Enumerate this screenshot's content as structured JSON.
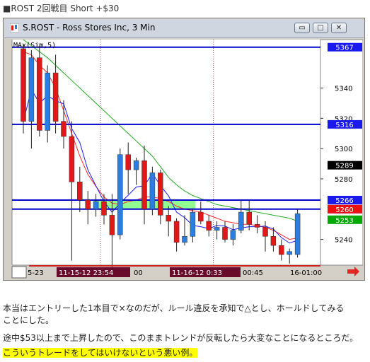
{
  "post_title": "■ROST 2回戦目 Short +$30",
  "window": {
    "title": "S.ROST - Ross Stores Inc, 3 Min",
    "buttons": [
      "▭",
      "□",
      "✕"
    ]
  },
  "chart_data": {
    "type": "candlestick",
    "indicator_label": "MAx(Sim,5)",
    "ylim": [
      5223,
      5372
    ],
    "y_ticks": [
      5340,
      5320,
      5300,
      5280,
      5240
    ],
    "x_tick_labels": [
      "5-23",
      "11-15-12 23:54",
      "00",
      "11-16-12  0:33",
      "00:45",
      "16-01:00"
    ],
    "candles": [
      {
        "o": 5366,
        "h": 5369,
        "l": 5310,
        "c": 5318
      },
      {
        "o": 5318,
        "h": 5365,
        "l": 5300,
        "c": 5360
      },
      {
        "o": 5360,
        "h": 5368,
        "l": 5308,
        "c": 5312
      },
      {
        "o": 5312,
        "h": 5355,
        "l": 5304,
        "c": 5350
      },
      {
        "o": 5350,
        "h": 5362,
        "l": 5310,
        "c": 5318
      },
      {
        "o": 5318,
        "h": 5332,
        "l": 5300,
        "c": 5308
      },
      {
        "o": 5308,
        "h": 5318,
        "l": 5226,
        "c": 5278
      },
      {
        "o": 5278,
        "h": 5288,
        "l": 5258,
        "c": 5266
      },
      {
        "o": 5266,
        "h": 5272,
        "l": 5250,
        "c": 5260
      },
      {
        "o": 5260,
        "h": 5270,
        "l": 5255,
        "c": 5265
      },
      {
        "o": 5265,
        "h": 5270,
        "l": 5250,
        "c": 5256
      },
      {
        "o": 5256,
        "h": 5270,
        "l": 5220,
        "c": 5243
      },
      {
        "o": 5243,
        "h": 5300,
        "l": 5240,
        "c": 5296
      },
      {
        "o": 5296,
        "h": 5304,
        "l": 5270,
        "c": 5286
      },
      {
        "o": 5286,
        "h": 5294,
        "l": 5276,
        "c": 5292
      },
      {
        "o": 5292,
        "h": 5302,
        "l": 5250,
        "c": 5260
      },
      {
        "o": 5260,
        "h": 5288,
        "l": 5256,
        "c": 5284
      },
      {
        "o": 5284,
        "h": 5286,
        "l": 5250,
        "c": 5256
      },
      {
        "o": 5256,
        "h": 5262,
        "l": 5242,
        "c": 5252
      },
      {
        "o": 5252,
        "h": 5254,
        "l": 5232,
        "c": 5238
      },
      {
        "o": 5238,
        "h": 5256,
        "l": 5236,
        "c": 5242
      },
      {
        "o": 5242,
        "h": 5260,
        "l": 5238,
        "c": 5258
      },
      {
        "o": 5258,
        "h": 5265,
        "l": 5250,
        "c": 5252
      },
      {
        "o": 5252,
        "h": 5256,
        "l": 5242,
        "c": 5246
      },
      {
        "o": 5246,
        "h": 5252,
        "l": 5240,
        "c": 5248
      },
      {
        "o": 5248,
        "h": 5252,
        "l": 5238,
        "c": 5240
      },
      {
        "o": 5240,
        "h": 5250,
        "l": 5236,
        "c": 5246
      },
      {
        "o": 5246,
        "h": 5266,
        "l": 5244,
        "c": 5258
      },
      {
        "o": 5258,
        "h": 5266,
        "l": 5246,
        "c": 5250
      },
      {
        "o": 5250,
        "h": 5256,
        "l": 5244,
        "c": 5248
      },
      {
        "o": 5248,
        "h": 5252,
        "l": 5232,
        "c": 5242
      },
      {
        "o": 5242,
        "h": 5248,
        "l": 5232,
        "c": 5236
      },
      {
        "o": 5236,
        "h": 5240,
        "l": 5226,
        "c": 5230
      },
      {
        "o": 5230,
        "h": 5234,
        "l": 5224,
        "c": 5232
      },
      {
        "o": 5230,
        "h": 5260,
        "l": 5228,
        "c": 5257
      }
    ],
    "ma_red": [
      5364,
      5362,
      5355,
      5350,
      5340,
      5325,
      5310,
      5295,
      5283,
      5275,
      5268,
      5264,
      5263,
      5265,
      5266,
      5268,
      5268,
      5267,
      5265,
      5262,
      5260,
      5259,
      5258,
      5256,
      5254,
      5252,
      5251,
      5250,
      5250,
      5249,
      5248,
      5246,
      5243,
      5240,
      5241
    ],
    "ma_green": [
      5372,
      5368,
      5364,
      5360,
      5355,
      5350,
      5345,
      5340,
      5335,
      5330,
      5325,
      5320,
      5315,
      5310,
      5305,
      5300,
      5295,
      5288,
      5281,
      5276,
      5272,
      5269,
      5267,
      5265,
      5263,
      5262,
      5261,
      5260,
      5259,
      5258,
      5257,
      5256,
      5255,
      5254,
      5252
    ],
    "h_lines": [
      {
        "value": 5367,
        "label": "5367",
        "color": "#0000cc"
      },
      {
        "value": 5316,
        "label": "5316",
        "color": "#0000cc"
      },
      {
        "value": 5266,
        "label": "5266",
        "color": "#0000cc"
      },
      {
        "value": 5260,
        "label": "5260",
        "color": "#0000cc"
      }
    ],
    "right_tags": [
      {
        "value": 5289,
        "label": "5289",
        "bg": "#000000",
        "fg": "#ffffff"
      },
      {
        "value": 5253,
        "label": "5253",
        "bg": "#00aa00",
        "fg": "#ffffff"
      },
      {
        "value": 5260,
        "label": "5260",
        "bg": "#ee1111",
        "fg": "#ffffff"
      }
    ],
    "zone": {
      "from_value": 5266,
      "to_value": 5260,
      "start_candle": 9,
      "end_candle": 21,
      "color": "#7fff7f"
    },
    "colors": {
      "up": "#2a7de1",
      "down": "#e01818",
      "blue_ma": "#1a1aff",
      "red_ma": "#ff2a2a",
      "green_ma": "#22aa22"
    }
  },
  "caption": {
    "line1": "本当はエントリーした1本目で×なのだが、ルール違反を承知で△とし、ホールドしてみる",
    "line2": "ことにした。",
    "line3": "途中$53以上まで上昇したので、このままトレンドが反転したら大変なことになるところだ。",
    "line4": "こういうトレードをしてはいけないという悪い例。"
  }
}
